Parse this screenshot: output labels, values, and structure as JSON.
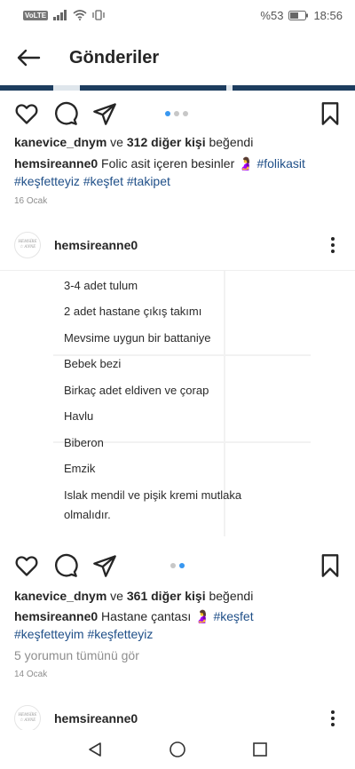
{
  "status": {
    "carrier_badge": "VoLTE",
    "battery": "%53",
    "time": "18:56"
  },
  "header": {
    "title": "Gönderiler"
  },
  "post1": {
    "liked_by": "kanevice_dnym",
    "likes_mid": " ve ",
    "likes_count": "312 diğer kişi",
    "likes_suffix": " beğendi",
    "author": "hemsireanne0",
    "caption": " Folic asit içeren besinler 🤰 ",
    "tag1": "#folikasit",
    "tag2": "#keşfetteyiz",
    "tag3": "#keşfet",
    "tag4": "#takipet",
    "date": "16 Ocak"
  },
  "post2": {
    "username": "hemsireanne0",
    "avatar_line1": "HEMSİRE",
    "avatar_line2": "☆ ANNE",
    "image_list": [
      "3-4 adet tulum",
      "2 adet hastane çıkış takımı",
      "Mevsime uygun bir battaniye",
      "Bebek bezi",
      "Birkaç adet eldiven ve çorap",
      "Havlu",
      "Biberon",
      "Emzik",
      "Islak mendil ve pişik kremi mutlaka",
      "olmalıdır."
    ],
    "liked_by": "kanevice_dnym",
    "likes_mid": " ve ",
    "likes_count": "361 diğer kişi",
    "likes_suffix": " beğendi",
    "author": "hemsireanne0",
    "caption": " Hastane çantası 🤰 ",
    "tag1": "#keşfet",
    "tag2": "#keşfetteyim",
    "tag3": "#keşfetteyiz",
    "comments": "5 yorumun tümünü gör",
    "date": "14 Ocak"
  },
  "post3": {
    "username": "hemsireanne0",
    "avatar_line1": "HEMSİRE",
    "avatar_line2": "☆ ANNE"
  },
  "icons": {
    "back": "arrow-left-icon",
    "like": "heart-icon",
    "comment": "comment-icon",
    "share": "send-icon",
    "save": "bookmark-icon",
    "more": "more-vertical-icon",
    "nav_back": "triangle-back-icon",
    "nav_home": "circle-home-icon",
    "nav_recent": "square-recent-icon"
  },
  "colors": {
    "link": "#1f4f88",
    "accent": "#3897f0",
    "muted": "#8e8e8e"
  }
}
